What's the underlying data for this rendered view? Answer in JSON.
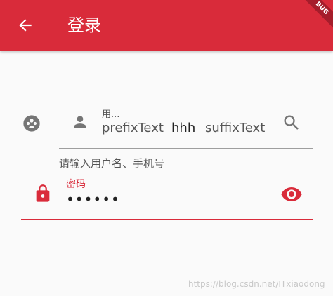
{
  "appbar": {
    "title": "登录",
    "back_icon": "arrow-back-icon",
    "debug_banner": "BUG",
    "background_color": "#d92b3a"
  },
  "username_field": {
    "label": "用...",
    "prefix_text": "prefixText",
    "value": "hhh",
    "suffix_text": "suffixText",
    "helper_text": "请输入用户名、手机号",
    "icon": "face-icon",
    "prefix_icon": "person-icon",
    "suffix_icon": "search-icon"
  },
  "password_field": {
    "label": "密码",
    "value": "••••••",
    "icon": "lock-icon",
    "suffix_icon": "eye-icon",
    "accent_color": "#d92b3a"
  },
  "watermark": "https://blog.csdn.net/ITxiaodong"
}
